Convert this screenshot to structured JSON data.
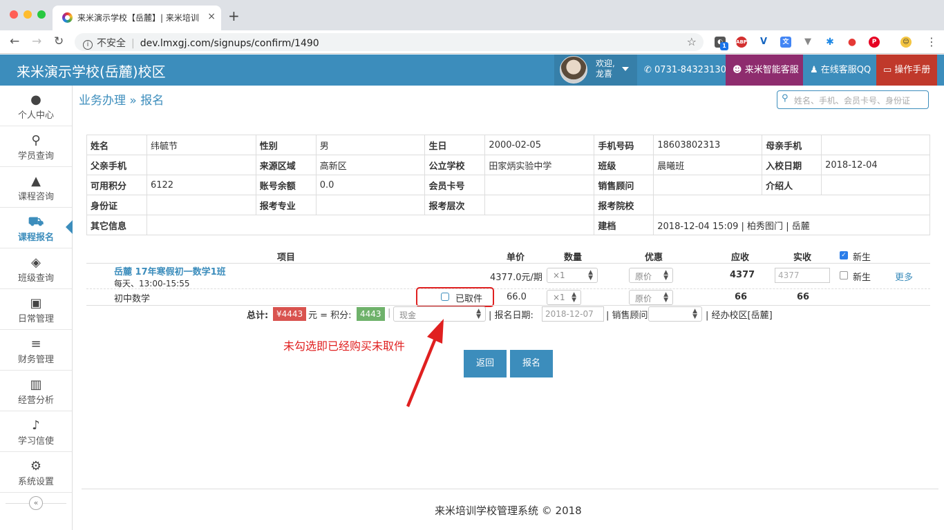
{
  "browser": {
    "tab_title": "来米演示学校【岳麓】| 来米培训",
    "tab_close": "×",
    "new_tab": "+",
    "security_label": "不安全",
    "url": "dev.lmxgj.com/signups/confirm/1490",
    "extension_badge": "1"
  },
  "header": {
    "school_name": "来米演示学校(岳麓)校区",
    "welcome": "欢迎,",
    "user_name": "龙喜",
    "phone": "0731-84323130",
    "smart_service": "来米智能客服",
    "qq_service": "在线客服QQ",
    "manual": "操作手册",
    "colors": {
      "primary": "#3c8dbc",
      "smart": "#8e2c6e",
      "manual": "#c0392b"
    }
  },
  "sidebar": {
    "items": [
      {
        "label": "个人中心",
        "icon": "user-icon"
      },
      {
        "label": "学员查询",
        "icon": "search-icon"
      },
      {
        "label": "课程咨询",
        "icon": "graduation-cap-icon"
      },
      {
        "label": "课程报名",
        "icon": "shopping-cart-icon",
        "active": true
      },
      {
        "label": "班级查询",
        "icon": "cubes-icon"
      },
      {
        "label": "日常管理",
        "icon": "calendar-icon"
      },
      {
        "label": "财务管理",
        "icon": "bars-icon"
      },
      {
        "label": "经营分析",
        "icon": "bar-chart-icon"
      },
      {
        "label": "学习信使",
        "icon": "twitter-bird-icon"
      },
      {
        "label": "系统设置",
        "icon": "gears-icon"
      }
    ],
    "collapse": "«"
  },
  "breadcrumb": {
    "parent": "业务办理",
    "sep": "»",
    "current": "报名"
  },
  "search": {
    "placeholder": "姓名、手机、会员卡号、身份证"
  },
  "student": {
    "labels": {
      "name": "姓名",
      "gender": "性别",
      "birthday": "生日",
      "mobile": "手机号码",
      "mother": "母亲手机",
      "father": "父亲手机",
      "region": "来源区域",
      "school": "公立学校",
      "class": "班级",
      "enroll": "入校日期",
      "points": "可用积分",
      "balance": "账号余额",
      "card": "会员卡号",
      "sales": "销售顾问",
      "referrer": "介绍人",
      "idcard": "身份证",
      "major": "报考专业",
      "level": "报考层次",
      "college": "报考院校",
      "other": "其它信息",
      "created": "建档"
    },
    "name": "纬毓节",
    "gender": "男",
    "birthday": "2000-02-05",
    "mobile": "18603802313",
    "mother": "",
    "father": "",
    "region": "高新区",
    "school": "田家炳实验中学",
    "class": "晨曦班",
    "enroll": "2018-12-04",
    "points": "6122",
    "balance": "0.0",
    "card": "",
    "sales": "",
    "referrer": "",
    "idcard": "",
    "major": "",
    "level": "",
    "college": "",
    "other": "",
    "created": "2018-12-04 15:09 | 柏秀图门 | 岳麓"
  },
  "order": {
    "headers": {
      "item": "项目",
      "price": "单价",
      "qty": "数量",
      "discount": "优惠",
      "receivable": "应收",
      "received": "实收",
      "new": "新生"
    },
    "course": {
      "name": "岳麓 17年寒假初一数学1班",
      "schedule": "每天、13:00-15:55",
      "price": "4377.0元/期",
      "qty": "×1",
      "discount": "原价",
      "receivable": "4377",
      "received": "4377",
      "new_label": "新生",
      "more": "更多"
    },
    "material": {
      "name": "初中数学",
      "taken_label": "已取件",
      "price": "66.0",
      "qty": "×1",
      "discount": "原价",
      "receivable": "66",
      "received": "66"
    },
    "totals": {
      "total_label": "总计:",
      "total": "¥4443",
      "eq": "元 = 积分:",
      "points": "4443",
      "pay_method": "现金",
      "date_label": "| 报名日期:",
      "date": "2018-12-07",
      "sales_label": "| 销售顾问",
      "campus": "| 经办校区[岳麓]"
    }
  },
  "annotation": "未勾选即已经购买未取件",
  "buttons": {
    "back": "返回",
    "signup": "报名"
  },
  "footer": "来米培训学校管理系统 © 2018"
}
